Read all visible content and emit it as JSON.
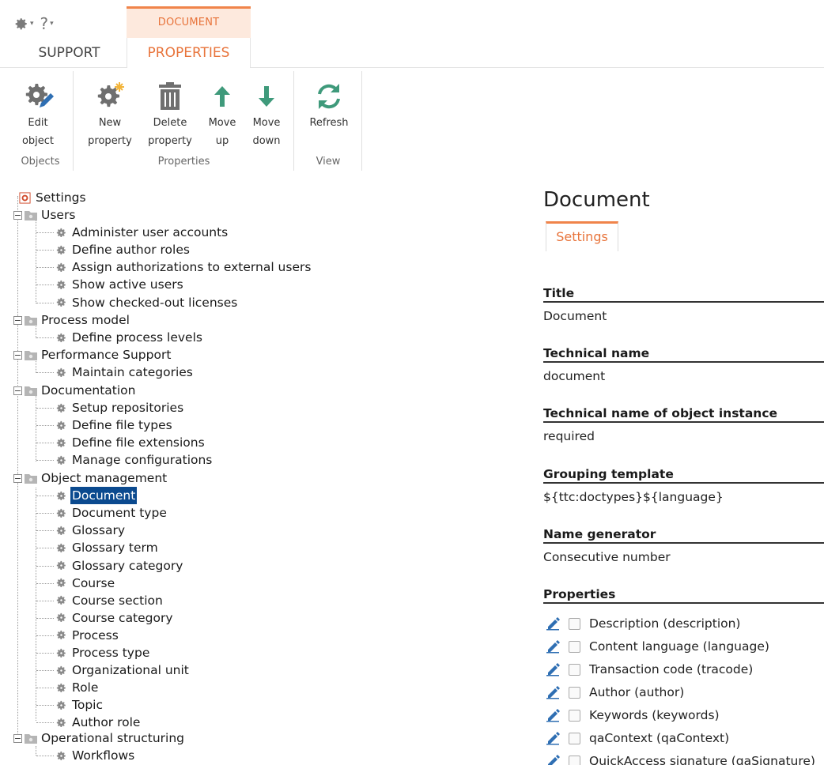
{
  "quick_access": {
    "settings_icon": "gear-icon",
    "help_label": "?"
  },
  "context": {
    "header": "DOCUMENT"
  },
  "tabs": [
    {
      "label": "SUPPORT"
    },
    {
      "label": "PROPERTIES"
    }
  ],
  "ribbon": {
    "groups": [
      {
        "label": "Objects",
        "buttons": [
          {
            "label1": "Edit",
            "label2": "object",
            "icon": "edit-gear-icon"
          }
        ]
      },
      {
        "label": "Properties",
        "buttons": [
          {
            "label1": "New",
            "label2": "property",
            "icon": "new-gear-icon"
          },
          {
            "label1": "Delete",
            "label2": "property",
            "icon": "trash-icon"
          },
          {
            "label1": "Move",
            "label2": "up",
            "icon": "arrow-up-icon"
          },
          {
            "label1": "Move",
            "label2": "down",
            "icon": "arrow-down-icon"
          }
        ]
      },
      {
        "label": "View",
        "buttons": [
          {
            "label1": "Refresh",
            "label2": "",
            "icon": "refresh-icon"
          }
        ]
      }
    ]
  },
  "tree": {
    "root": "Settings",
    "groups": [
      {
        "label": "Users",
        "items": [
          "Administer user accounts",
          "Define author roles",
          "Assign authorizations to external users",
          "Show active users",
          "Show checked-out licenses"
        ]
      },
      {
        "label": "Process model",
        "items": [
          "Define process levels"
        ]
      },
      {
        "label": "Performance Support",
        "items": [
          "Maintain categories"
        ]
      },
      {
        "label": "Documentation",
        "items": [
          "Setup repositories",
          "Define file types",
          "Define file extensions",
          "Manage configurations"
        ]
      },
      {
        "label": "Object management",
        "items": [
          "Document",
          "Document type",
          "Glossary",
          "Glossary term",
          "Glossary category",
          "Course",
          "Course section",
          "Course category",
          "Process",
          "Process type",
          "Organizational unit",
          "Role",
          "Topic",
          "Author role"
        ]
      },
      {
        "label": "Operational structuring",
        "items": [
          "Workflows"
        ]
      }
    ],
    "selected": "Document"
  },
  "detail": {
    "title": "Document",
    "tab": "Settings",
    "fields": [
      {
        "label": "Title",
        "value": "Document"
      },
      {
        "label": "Technical name",
        "value": "document"
      },
      {
        "label": "Technical name of object instance",
        "value": "required"
      },
      {
        "label": "Grouping template",
        "value": "${ttc:doctypes}${language}"
      },
      {
        "label": "Name generator",
        "value": "Consecutive number"
      }
    ],
    "properties_label": "Properties",
    "properties": [
      "Description (description)",
      "Content language (language)",
      "Transaction code (tracode)",
      "Author (author)",
      "Keywords (keywords)",
      "qaContext (qaContext)",
      "QuickAccess signature (qaSignature)"
    ]
  },
  "colors": {
    "accent": "#e8743b",
    "selection": "#0b4a8f",
    "icon_gray": "#6f6f6f",
    "arrow_green": "#3f9a7b",
    "pencil_blue": "#2f6fb3"
  }
}
